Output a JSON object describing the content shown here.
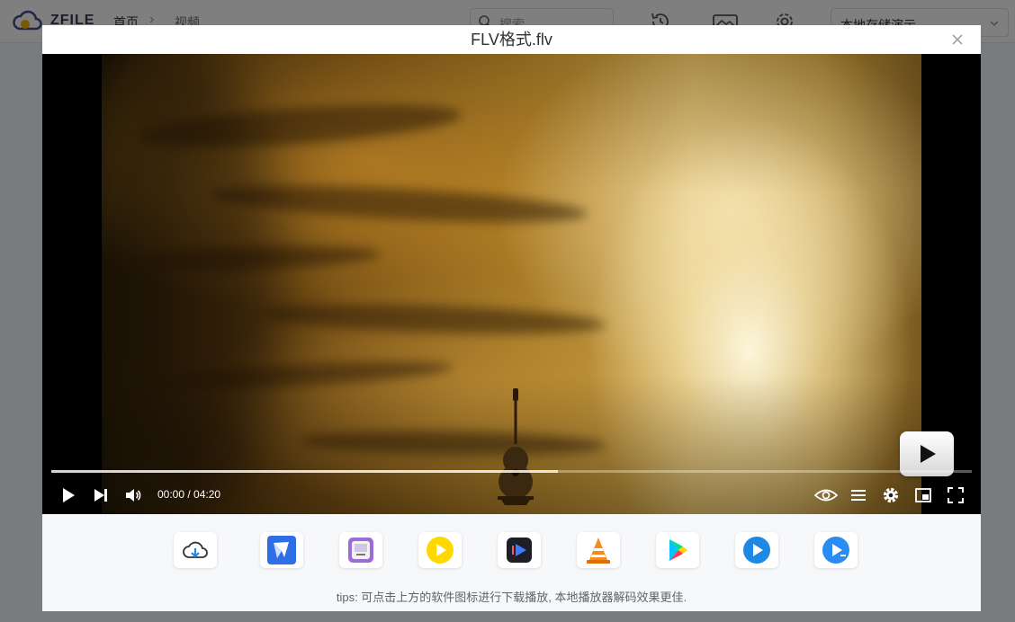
{
  "app": {
    "logo_text": "ZFILE",
    "breadcrumb": [
      "首页",
      "视频"
    ],
    "search_placeholder": "搜索",
    "storage_selected": "本地存储演示"
  },
  "dialog": {
    "title": "FLV格式.flv"
  },
  "player": {
    "current_time": "00:00",
    "duration": "04:20",
    "time_display": "00:00 / 04:20",
    "buffered_fraction": 0.55,
    "played_fraction": 0
  },
  "external_players": [
    {
      "icon": "cloud-download-icon"
    },
    {
      "icon": "potplayer-icon"
    },
    {
      "icon": "iina-icon"
    },
    {
      "icon": "yellow-player-icon"
    },
    {
      "icon": "dark-player-icon"
    },
    {
      "icon": "vlc-icon"
    },
    {
      "icon": "google-play-icon"
    },
    {
      "icon": "blue-player-icon"
    },
    {
      "icon": "mx-player-icon"
    }
  ],
  "tips": "tips: 可点击上方的软件图标进行下载播放, 本地播放器解码效果更佳.",
  "colors": {
    "overlay": "#000000",
    "dialog_bg": "#ffffff",
    "apps_bg": "#f7f8fa",
    "accent_blue": "#1e88e5"
  }
}
